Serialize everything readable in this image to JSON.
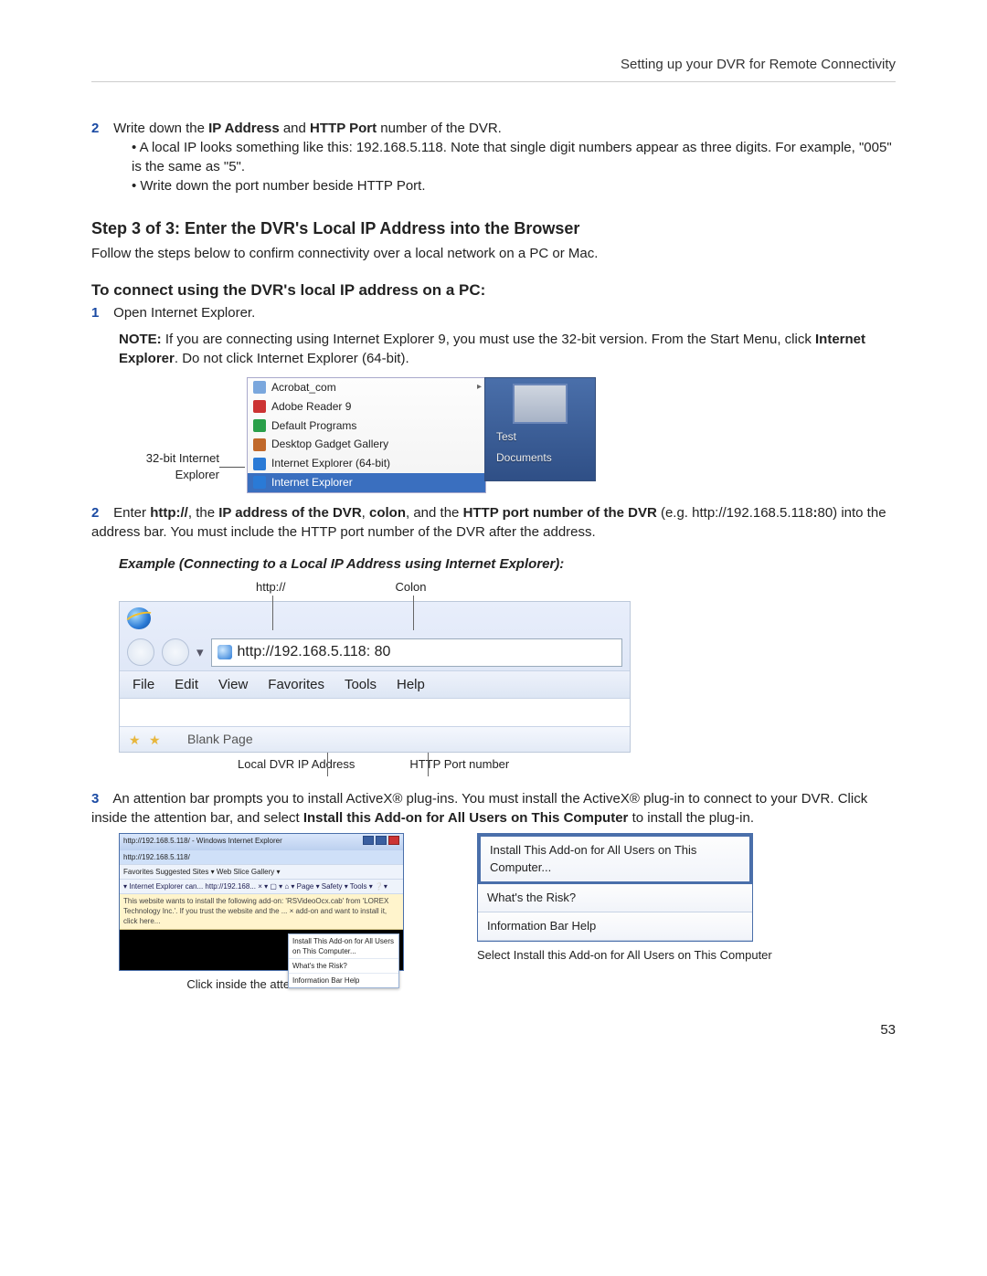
{
  "header": {
    "title": "Setting up your DVR for Remote Connectivity"
  },
  "page_number": "53",
  "s2": {
    "num": "2",
    "lead": "Write down the ",
    "b1": "IP Address",
    "mid1": " and ",
    "b2": "HTTP Port",
    "tail": " number of the DVR.",
    "bullet1": "A local IP looks something like this: 192.168.5.118. Note that single digit numbers appear as three digits. For example, \"005\" is the same as \"5\".",
    "bullet2": "Write down the port number beside HTTP Port."
  },
  "step3_heading": "Step 3 of 3: Enter the DVR's Local IP Address into the Browser",
  "step3_intro": "Follow the steps below to confirm connectivity over a local network on a PC or Mac.",
  "pc_heading": "To connect using the DVR's local IP address on a PC:",
  "p1": {
    "num": "1",
    "text": "Open Internet Explorer."
  },
  "note": {
    "label": "NOTE:",
    "a": " If you are connecting using Internet Explorer 9, you must use the 32-bit version. From the Start Menu, click ",
    "b": "Internet Explorer",
    "c": ". Do not click Internet Explorer (64-bit)."
  },
  "fig1": {
    "caption": "32-bit Internet Explorer",
    "items": [
      "Acrobat_com",
      "Adobe Reader 9",
      "Default Programs",
      "Desktop Gadget Gallery",
      "Internet Explorer (64-bit)",
      "Internet Explorer"
    ],
    "rp1": "Test",
    "rp2": "Documents"
  },
  "p2": {
    "num": "2",
    "a": "Enter ",
    "b1": "http://",
    "c": ", the ",
    "b2": "IP address of the DVR",
    "d": ", ",
    "b3": "colon",
    "e": ", and the ",
    "b4": "HTTP port number of the DVR",
    "f": " (e.g. http://192.168.5.118",
    "b5": ":",
    "g": "80) into the address bar. You must include the HTTP port number of the DVR after the address."
  },
  "example_heading": "Example (Connecting to a Local IP Address using Internet Explorer):",
  "fig2": {
    "top_http": "http://",
    "top_colon": "Colon",
    "url": "http://192.168.5.118: 80",
    "menu": [
      "File",
      "Edit",
      "View",
      "Favorites",
      "Tools",
      "Help"
    ],
    "tab": "Blank Page",
    "bot_ip": "Local DVR IP Address",
    "bot_port": "HTTP Port number"
  },
  "p3": {
    "num": "3",
    "a": "An attention bar prompts you to install ActiveX® plug-ins. You must install the ActiveX® plug-in to connect to your DVR. Click inside the attention bar, and select ",
    "b1": "Install this Add-on for All Users on This Computer",
    "c": " to install the plug-in."
  },
  "fig3": {
    "title": "http://192.168.5.118/ - Windows Internet Explorer",
    "addr": "http://192.168.5.118/",
    "fav": "Favorites    Suggested Sites ▾    Web Slice Gallery ▾",
    "toolrow": "▾  Internet Explorer can...  http://192.168...  ×          ▾  ▢  ▾  ⌂ ▾  Page ▾  Safety ▾  Tools ▾  ❔▾",
    "warn": "This website wants to install the following add-on: 'RSVideoOcx.cab' from 'LOREX Technology Inc.'. If you trust the website and the ... ×  add-on and want to install it, click here...",
    "ctx1": "Install This Add-on for All Users on This Computer...",
    "ctx2": "What's the Risk?",
    "ctx3": "Information Bar Help",
    "caption_left": "Click inside the attention bar",
    "menu1": "Install This Add-on for All Users on This Computer...",
    "menu2": "What's the Risk?",
    "menu3": "Information Bar Help",
    "caption_right": "Select Install this Add-on for All Users on This Computer"
  }
}
